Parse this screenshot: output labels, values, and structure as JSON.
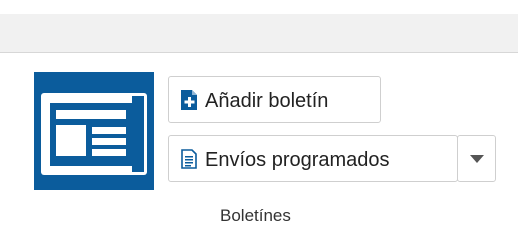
{
  "ribbon": {
    "app_icon": "newsletter-icon",
    "accent_color": "#0b5c9c",
    "buttons": {
      "add_newsletter": {
        "label": "Añadir boletín",
        "icon": "new-document-icon"
      },
      "scheduled_sends": {
        "label": "Envíos programados",
        "icon": "document-list-icon",
        "dropdown_icon": "caret-down-icon"
      }
    },
    "group_label": "Boletínes"
  }
}
